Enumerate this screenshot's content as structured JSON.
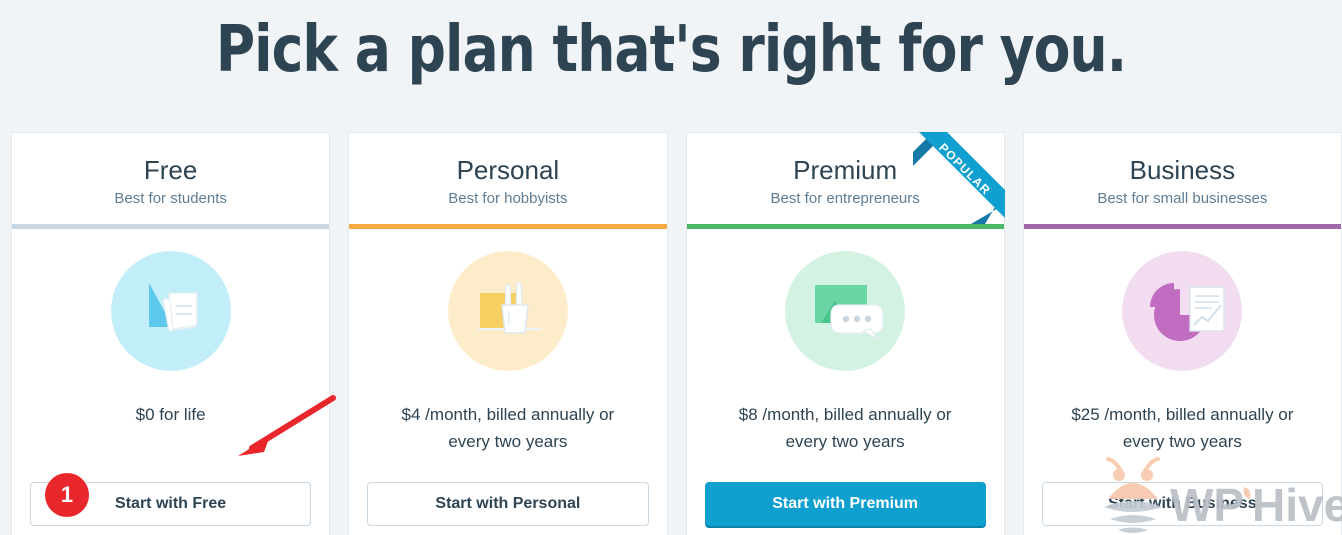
{
  "page": {
    "title": "Pick a plan that's right for you.",
    "background_color": "#f1f4f7",
    "title_color": "#2e4453"
  },
  "plans": [
    {
      "name": "Free",
      "tagline": "Best for students",
      "accent_color": "#c8d7e1",
      "icon_name": "cursor-document-icon",
      "icon_circle_color": "#c2eef9",
      "price": "$0 for life",
      "cta_label": "Start with Free",
      "cta_style": "outline",
      "popular": false
    },
    {
      "name": "Personal",
      "tagline": "Best for hobbyists",
      "accent_color": "#f4a942",
      "icon_name": "pencil-cup-icon",
      "icon_circle_color": "#fdecca",
      "price": "$4 /month, billed annually or every two years",
      "cta_label": "Start with Personal",
      "cta_style": "outline",
      "popular": false
    },
    {
      "name": "Premium",
      "tagline": "Best for entrepreneurs",
      "accent_color": "#4ab866",
      "icon_name": "image-chat-icon",
      "icon_circle_color": "#d3f2e1",
      "price": "$8 /month, billed annually or every two years",
      "cta_label": "Start with Premium",
      "cta_style": "filled",
      "popular": true,
      "ribbon_label": "POPULAR",
      "ribbon_color": "#0fa0d0"
    },
    {
      "name": "Business",
      "tagline": "Best for small businesses",
      "accent_color": "#9e69ab",
      "icon_name": "pie-chart-report-icon",
      "icon_circle_color": "#f1dcf0",
      "price": "$25 /month, billed annually or every two years",
      "cta_label": "Start with Business",
      "cta_style": "outline",
      "popular": false
    }
  ],
  "annotation": {
    "badge_number": "1",
    "badge_color": "#e8262b",
    "arrow_color": "#e8262b"
  },
  "watermark": {
    "text_wp": "WP",
    "text_hive": "Hive",
    "text_color": "#b9bfc6",
    "bee_color": "#f8c8ac"
  }
}
